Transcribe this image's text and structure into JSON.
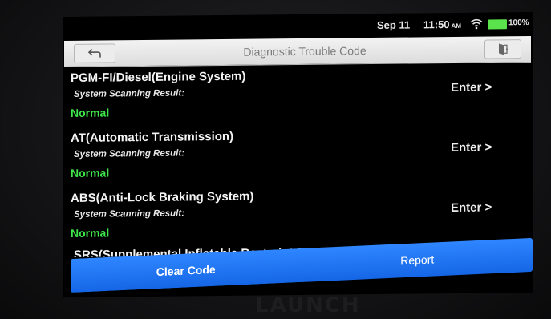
{
  "status_bar": {
    "date": "Sep 11",
    "time": "11:50",
    "ampm": "AM",
    "battery_percent": "100%",
    "battery_level": 1.0,
    "icons": [
      "wifi-icon",
      "battery-icon"
    ]
  },
  "title_bar": {
    "title": "Diagnostic Trouble Code",
    "back_icon": "back-arrow-icon",
    "exit_icon": "exit-door-icon"
  },
  "systems": [
    {
      "name": "PGM-FI/Diesel(Engine System)",
      "scan_label": "System Scanning Result:",
      "result": "Normal",
      "action": "Enter >"
    },
    {
      "name": "AT(Automatic Transmission)",
      "scan_label": "System Scanning Result:",
      "result": "Normal",
      "action": "Enter >"
    },
    {
      "name": "ABS(Anti-Lock Braking System)",
      "scan_label": "System Scanning Result:",
      "result": "Normal",
      "action": "Enter >"
    },
    {
      "name": "SRS(Supplemental Inflatable Restraint System)"
    }
  ],
  "bottom_bar": {
    "clear_code_label": "Clear Code",
    "report_label": "Report"
  },
  "device": {
    "brand": "LAUNCH"
  },
  "colors": {
    "accent": "#1f74f5",
    "normal_status": "#3ee84a",
    "screen_bg": "#000000"
  }
}
